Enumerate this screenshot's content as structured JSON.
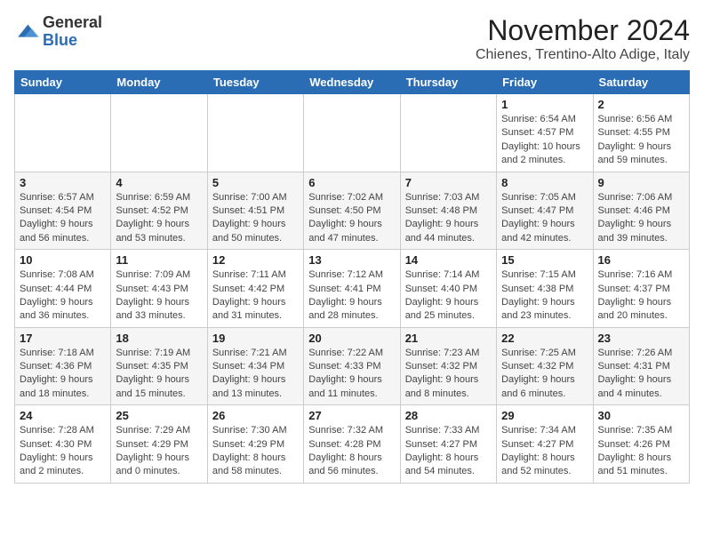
{
  "header": {
    "logo_general": "General",
    "logo_blue": "Blue",
    "month_title": "November 2024",
    "location": "Chienes, Trentino-Alto Adige, Italy"
  },
  "weekdays": [
    "Sunday",
    "Monday",
    "Tuesday",
    "Wednesday",
    "Thursday",
    "Friday",
    "Saturday"
  ],
  "weeks": [
    [
      {
        "day": "",
        "info": ""
      },
      {
        "day": "",
        "info": ""
      },
      {
        "day": "",
        "info": ""
      },
      {
        "day": "",
        "info": ""
      },
      {
        "day": "",
        "info": ""
      },
      {
        "day": "1",
        "info": "Sunrise: 6:54 AM\nSunset: 4:57 PM\nDaylight: 10 hours\nand 2 minutes."
      },
      {
        "day": "2",
        "info": "Sunrise: 6:56 AM\nSunset: 4:55 PM\nDaylight: 9 hours\nand 59 minutes."
      }
    ],
    [
      {
        "day": "3",
        "info": "Sunrise: 6:57 AM\nSunset: 4:54 PM\nDaylight: 9 hours\nand 56 minutes."
      },
      {
        "day": "4",
        "info": "Sunrise: 6:59 AM\nSunset: 4:52 PM\nDaylight: 9 hours\nand 53 minutes."
      },
      {
        "day": "5",
        "info": "Sunrise: 7:00 AM\nSunset: 4:51 PM\nDaylight: 9 hours\nand 50 minutes."
      },
      {
        "day": "6",
        "info": "Sunrise: 7:02 AM\nSunset: 4:50 PM\nDaylight: 9 hours\nand 47 minutes."
      },
      {
        "day": "7",
        "info": "Sunrise: 7:03 AM\nSunset: 4:48 PM\nDaylight: 9 hours\nand 44 minutes."
      },
      {
        "day": "8",
        "info": "Sunrise: 7:05 AM\nSunset: 4:47 PM\nDaylight: 9 hours\nand 42 minutes."
      },
      {
        "day": "9",
        "info": "Sunrise: 7:06 AM\nSunset: 4:46 PM\nDaylight: 9 hours\nand 39 minutes."
      }
    ],
    [
      {
        "day": "10",
        "info": "Sunrise: 7:08 AM\nSunset: 4:44 PM\nDaylight: 9 hours\nand 36 minutes."
      },
      {
        "day": "11",
        "info": "Sunrise: 7:09 AM\nSunset: 4:43 PM\nDaylight: 9 hours\nand 33 minutes."
      },
      {
        "day": "12",
        "info": "Sunrise: 7:11 AM\nSunset: 4:42 PM\nDaylight: 9 hours\nand 31 minutes."
      },
      {
        "day": "13",
        "info": "Sunrise: 7:12 AM\nSunset: 4:41 PM\nDaylight: 9 hours\nand 28 minutes."
      },
      {
        "day": "14",
        "info": "Sunrise: 7:14 AM\nSunset: 4:40 PM\nDaylight: 9 hours\nand 25 minutes."
      },
      {
        "day": "15",
        "info": "Sunrise: 7:15 AM\nSunset: 4:38 PM\nDaylight: 9 hours\nand 23 minutes."
      },
      {
        "day": "16",
        "info": "Sunrise: 7:16 AM\nSunset: 4:37 PM\nDaylight: 9 hours\nand 20 minutes."
      }
    ],
    [
      {
        "day": "17",
        "info": "Sunrise: 7:18 AM\nSunset: 4:36 PM\nDaylight: 9 hours\nand 18 minutes."
      },
      {
        "day": "18",
        "info": "Sunrise: 7:19 AM\nSunset: 4:35 PM\nDaylight: 9 hours\nand 15 minutes."
      },
      {
        "day": "19",
        "info": "Sunrise: 7:21 AM\nSunset: 4:34 PM\nDaylight: 9 hours\nand 13 minutes."
      },
      {
        "day": "20",
        "info": "Sunrise: 7:22 AM\nSunset: 4:33 PM\nDaylight: 9 hours\nand 11 minutes."
      },
      {
        "day": "21",
        "info": "Sunrise: 7:23 AM\nSunset: 4:32 PM\nDaylight: 9 hours\nand 8 minutes."
      },
      {
        "day": "22",
        "info": "Sunrise: 7:25 AM\nSunset: 4:32 PM\nDaylight: 9 hours\nand 6 minutes."
      },
      {
        "day": "23",
        "info": "Sunrise: 7:26 AM\nSunset: 4:31 PM\nDaylight: 9 hours\nand 4 minutes."
      }
    ],
    [
      {
        "day": "24",
        "info": "Sunrise: 7:28 AM\nSunset: 4:30 PM\nDaylight: 9 hours\nand 2 minutes."
      },
      {
        "day": "25",
        "info": "Sunrise: 7:29 AM\nSunset: 4:29 PM\nDaylight: 9 hours\nand 0 minutes."
      },
      {
        "day": "26",
        "info": "Sunrise: 7:30 AM\nSunset: 4:29 PM\nDaylight: 8 hours\nand 58 minutes."
      },
      {
        "day": "27",
        "info": "Sunrise: 7:32 AM\nSunset: 4:28 PM\nDaylight: 8 hours\nand 56 minutes."
      },
      {
        "day": "28",
        "info": "Sunrise: 7:33 AM\nSunset: 4:27 PM\nDaylight: 8 hours\nand 54 minutes."
      },
      {
        "day": "29",
        "info": "Sunrise: 7:34 AM\nSunset: 4:27 PM\nDaylight: 8 hours\nand 52 minutes."
      },
      {
        "day": "30",
        "info": "Sunrise: 7:35 AM\nSunset: 4:26 PM\nDaylight: 8 hours\nand 51 minutes."
      }
    ]
  ]
}
